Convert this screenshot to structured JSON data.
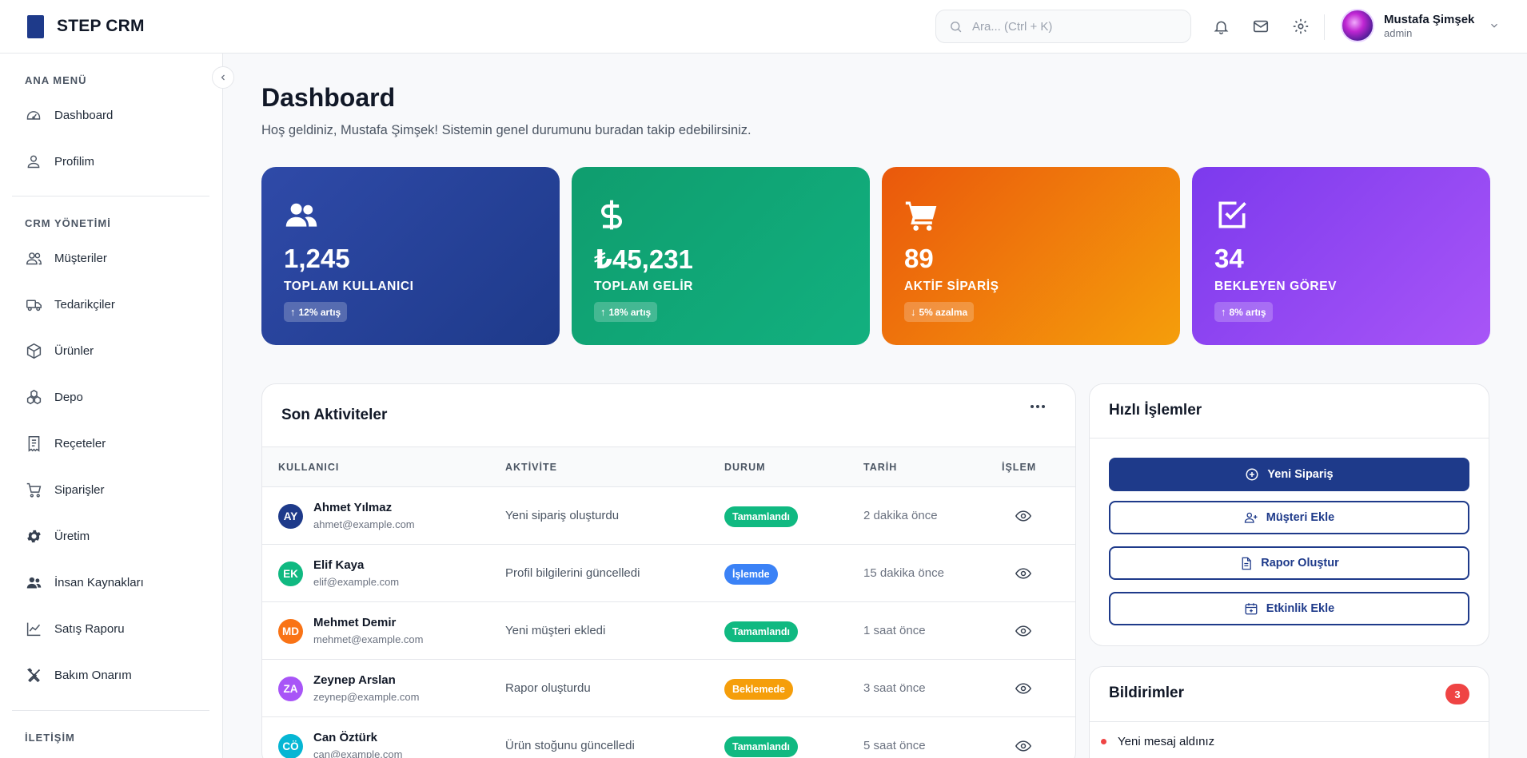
{
  "brand": {
    "name": "STEP CRM"
  },
  "header": {
    "search_placeholder": "Ara... (Ctrl + K)",
    "user": {
      "name": "Mustafa Şimşek",
      "role": "admin"
    }
  },
  "sidebar": {
    "sections": [
      {
        "title": "ANA MENÜ",
        "items": [
          {
            "label": "Dashboard",
            "icon": "gauge-icon"
          },
          {
            "label": "Profilim",
            "icon": "user-icon"
          }
        ]
      },
      {
        "title": "CRM YÖNETİMİ",
        "items": [
          {
            "label": "Müşteriler",
            "icon": "users-icon"
          },
          {
            "label": "Tedarikçiler",
            "icon": "truck-icon"
          },
          {
            "label": "Ürünler",
            "icon": "box-icon"
          },
          {
            "label": "Depo",
            "icon": "boxes-icon"
          },
          {
            "label": "Reçeteler",
            "icon": "receipt-icon"
          },
          {
            "label": "Siparişler",
            "icon": "cart-icon"
          },
          {
            "label": "Üretim",
            "icon": "gear-icon"
          },
          {
            "label": "İnsan Kaynakları",
            "icon": "people-icon"
          },
          {
            "label": "Satış Raporu",
            "icon": "chart-line-icon"
          },
          {
            "label": "Bakım Onarım",
            "icon": "tools-icon"
          }
        ]
      },
      {
        "title": "İLETİŞİM",
        "items": []
      }
    ]
  },
  "main": {
    "title": "Dashboard",
    "subtitle": "Hoş geldiniz, Mustafa Şimşek! Sistemin genel durumunu buradan takip edebilirsiniz."
  },
  "stats": [
    {
      "value": "1,245",
      "label": "TOPLAM KULLANICI",
      "badge": "12% artış",
      "trend": "up",
      "icon": "users-icon",
      "colors": [
        "#2f4aa8",
        "#1e3a8a"
      ]
    },
    {
      "value": "₺45,231",
      "label": "TOPLAM GELİR",
      "badge": "18% artış",
      "trend": "up",
      "icon": "dollar-icon",
      "colors": [
        "#0f9d6e",
        "#12b07f"
      ]
    },
    {
      "value": "89",
      "label": "AKTİF SİPARİŞ",
      "badge": "5% azalma",
      "trend": "down",
      "icon": "cart-icon",
      "colors": [
        "#ea580c",
        "#f59e0b"
      ]
    },
    {
      "value": "34",
      "label": "BEKLEYEN GÖREV",
      "badge": "8% artış",
      "trend": "up",
      "icon": "check-square-icon",
      "colors": [
        "#7c3aed",
        "#a855f7"
      ]
    }
  ],
  "activities": {
    "title": "Son Aktiviteler",
    "columns": [
      "KULLANICI",
      "AKTİVİTE",
      "DURUM",
      "TARİH",
      "İŞLEM"
    ],
    "rows": [
      {
        "initials": "AY",
        "name": "Ahmet Yılmaz",
        "email": "ahmet@example.com",
        "activity": "Yeni sipariş oluşturdu",
        "status": "Tamamlandı",
        "date": "2 dakika önce",
        "avatar_color": "#1e3a8a",
        "status_color": "#10b981"
      },
      {
        "initials": "EK",
        "name": "Elif Kaya",
        "email": "elif@example.com",
        "activity": "Profil bilgilerini güncelledi",
        "status": "İşlemde",
        "date": "15 dakika önce",
        "avatar_color": "#10b981",
        "status_color": "#3b82f6"
      },
      {
        "initials": "MD",
        "name": "Mehmet Demir",
        "email": "mehmet@example.com",
        "activity": "Yeni müşteri ekledi",
        "status": "Tamamlandı",
        "date": "1 saat önce",
        "avatar_color": "#f97316",
        "status_color": "#10b981"
      },
      {
        "initials": "ZA",
        "name": "Zeynep Arslan",
        "email": "zeynep@example.com",
        "activity": "Rapor oluşturdu",
        "status": "Beklemede",
        "date": "3 saat önce",
        "avatar_color": "#a855f7",
        "status_color": "#f59e0b"
      },
      {
        "initials": "CÖ",
        "name": "Can Öztürk",
        "email": "can@example.com",
        "activity": "Ürün stoğunu güncelledi",
        "status": "Tamamlandı",
        "date": "5 saat önce",
        "avatar_color": "#06b6d4",
        "status_color": "#10b981"
      }
    ]
  },
  "quick_actions": {
    "title": "Hızlı İşlemler",
    "buttons": [
      {
        "label": "Yeni Sipariş",
        "icon": "plus-circle-icon"
      },
      {
        "label": "Müşteri Ekle",
        "icon": "user-plus-icon"
      },
      {
        "label": "Rapor Oluştur",
        "icon": "file-icon"
      },
      {
        "label": "Etkinlik Ekle",
        "icon": "calendar-plus-icon"
      }
    ]
  },
  "notifications": {
    "title": "Bildirimler",
    "count": "3",
    "items": [
      {
        "text": "Yeni mesaj aldınız"
      }
    ]
  }
}
